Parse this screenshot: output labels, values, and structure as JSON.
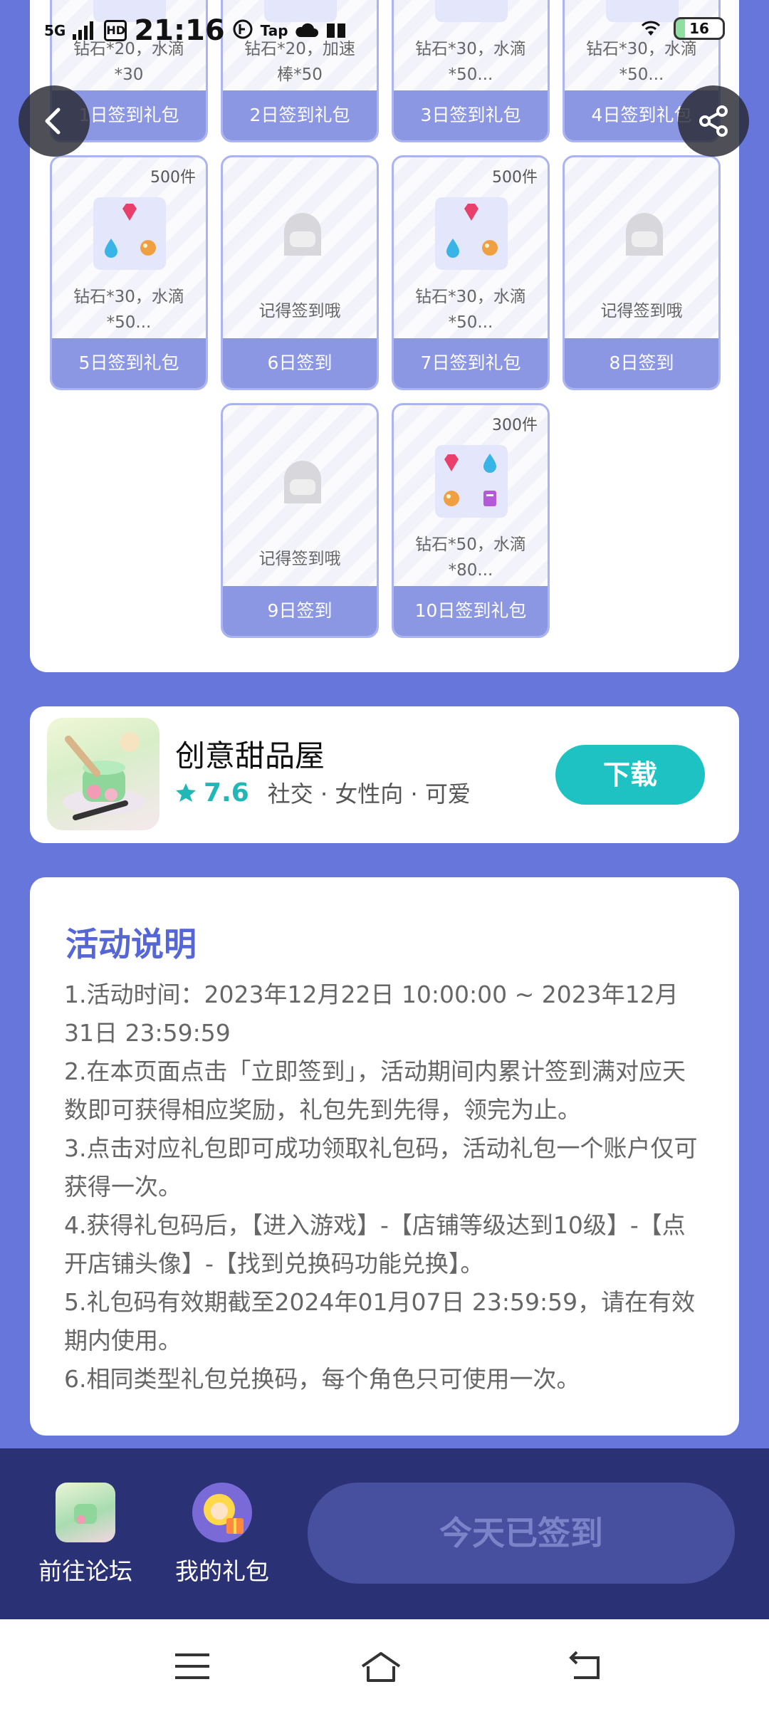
{
  "status_bar": {
    "network": "5G",
    "hd": "HD",
    "time": "21:16",
    "tap_label": "Tap",
    "battery": "16"
  },
  "cards": [
    {
      "desc": "钻石*20，水滴\n*30",
      "footer": "1日签到礼包",
      "count": ""
    },
    {
      "desc": "钻石*20，加速\n棒*50",
      "footer": "2日签到礼包",
      "count": ""
    },
    {
      "desc": "钻石*30，水滴\n*50...",
      "footer": "3日签到礼包",
      "count": ""
    },
    {
      "desc": "钻石*30，水滴\n*50...",
      "footer": "4日签到礼包",
      "count": ""
    },
    {
      "desc": "钻石*30，水滴\n*50...",
      "footer": "5日签到礼包",
      "count": "500件"
    },
    {
      "desc": "记得签到哦",
      "footer": "6日签到",
      "count": ""
    },
    {
      "desc": "钻石*30，水滴\n*50...",
      "footer": "7日签到礼包",
      "count": "500件"
    },
    {
      "desc": "记得签到哦",
      "footer": "8日签到",
      "count": ""
    },
    {
      "desc": "记得签到哦",
      "footer": "9日签到",
      "count": ""
    },
    {
      "desc": "钻石*50，水滴\n*80...",
      "footer": "10日签到礼包",
      "count": "300件"
    }
  ],
  "app": {
    "name": "创意甜品屋",
    "rating": "7.6",
    "tags": "社交 · 女性向 · 可爱",
    "download_label": "下载"
  },
  "activity": {
    "title": "活动说明",
    "lines": [
      "1.活动时间：2023年12月22日 10:00:00 ~ 2023年12月31日 23:59:59",
      "2.在本页面点击「立即签到」，活动期间内累计签到满对应天数即可获得相应奖励，礼包先到先得，领完为止。",
      "3.点击对应礼包即可成功领取礼包码，活动礼包一个账户仅可获得一次。",
      "4.获得礼包码后，【进入游戏】-【店铺等级达到10级】-【点开店铺头像】-【找到兑换码功能兑换】。",
      "5.礼包码有效期截至2024年01月07日 23:59:59，请在有效期内使用。",
      "6.相同类型礼包兑换码，每个角色只可使用一次。"
    ]
  },
  "bottom_bar": {
    "forum_label": "前往论坛",
    "gifts_label": "我的礼包",
    "signed_label": "今天已签到"
  },
  "icons": {
    "back": "back-arrow-icon",
    "share": "share-icon",
    "star": "star-icon",
    "ghost": "locked-ghost-icon"
  },
  "colors": {
    "page_bg": "#6676db",
    "card_footer": "#8b97e3",
    "accent_teal": "#1fc2c2",
    "title_blue": "#5566d6",
    "action_bar": "#2b3175",
    "signed_btn": "#46509e"
  }
}
